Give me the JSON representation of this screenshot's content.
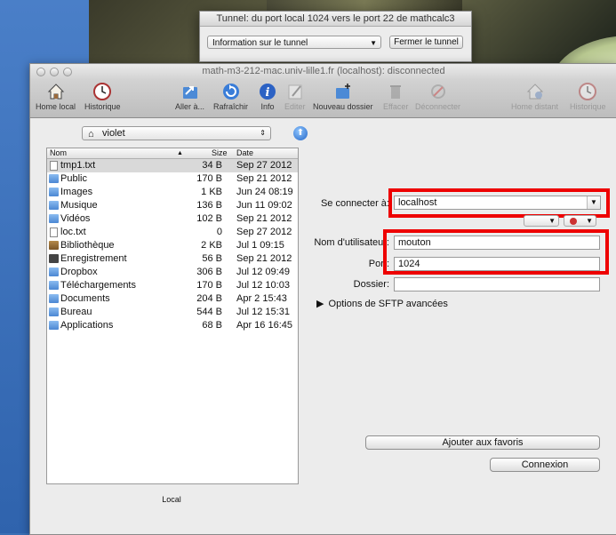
{
  "tunnel": {
    "title": "Tunnel: du port local 1024 vers le port 22 de mathcalc3",
    "select_value": "Information sur le tunnel",
    "close_label": "Fermer le tunnel"
  },
  "window": {
    "title": "math-m3-212-mac.univ-lille1.fr (localhost): disconnected"
  },
  "toolbar": {
    "home_local": "Home local",
    "history_left": "Historique",
    "goto": "Aller à...",
    "refresh": "Rafraîchir",
    "info": "Info",
    "edit": "Editer",
    "new_folder": "Nouveau dossier",
    "erase": "Effacer",
    "disconnect": "Déconnecter",
    "home_remote": "Home distant",
    "history_right": "Historique"
  },
  "local": {
    "path": "violet",
    "footer": "Local",
    "columns": {
      "name": "Nom",
      "size": "Size",
      "date": "Date"
    },
    "files": [
      {
        "name": "tmp1.txt",
        "size": "34 B",
        "date": "Sep 27 2012",
        "kind": "doc"
      },
      {
        "name": "Public",
        "size": "170 B",
        "date": "Sep 21 2012",
        "kind": "folder"
      },
      {
        "name": "Images",
        "size": "1 KB",
        "date": "Jun 24 08:19",
        "kind": "folder"
      },
      {
        "name": "Musique",
        "size": "136 B",
        "date": "Jun 11 09:02",
        "kind": "folder"
      },
      {
        "name": "Vidéos",
        "size": "102 B",
        "date": "Sep 21 2012",
        "kind": "folder"
      },
      {
        "name": "loc.txt",
        "size": "0",
        "date": "Sep 27 2012",
        "kind": "doc"
      },
      {
        "name": "Bibliothèque",
        "size": "2 KB",
        "date": "Jul 1 09:15",
        "kind": "lib"
      },
      {
        "name": "Enregistrement",
        "size": "56 B",
        "date": "Sep 21 2012",
        "kind": "rec"
      },
      {
        "name": "Dropbox",
        "size": "306 B",
        "date": "Jul 12 09:49",
        "kind": "folder"
      },
      {
        "name": "Téléchargements",
        "size": "170 B",
        "date": "Jul 12 10:03",
        "kind": "folder"
      },
      {
        "name": "Documents",
        "size": "204 B",
        "date": "Apr 2 15:43",
        "kind": "folder"
      },
      {
        "name": "Bureau",
        "size": "544 B",
        "date": "Jul 12 15:31",
        "kind": "folder"
      },
      {
        "name": "Applications",
        "size": "68 B",
        "date": "Apr 16 16:45",
        "kind": "folder"
      }
    ]
  },
  "connect": {
    "host_label": "Se connecter à:",
    "host_value": "localhost",
    "user_label": "Nom d'utilisateur:",
    "user_value": "mouton",
    "port_label": "Port:",
    "port_value": "1024",
    "folder_label": "Dossier:",
    "folder_value": "",
    "advanced_label": "Options de SFTP avancées",
    "favorites_label": "Ajouter aux favoris",
    "connect_label": "Connexion"
  },
  "colors": {
    "highlight": "#ee0000",
    "selection": "#d9d9d9"
  }
}
